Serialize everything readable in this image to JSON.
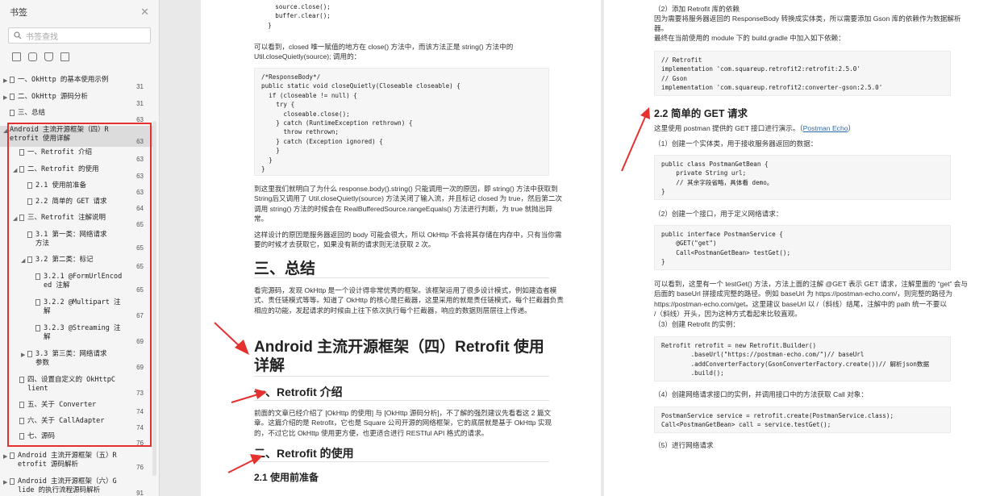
{
  "sidebar": {
    "title": "书签",
    "search_placeholder": "书签查找",
    "items": [
      {
        "label": "一、OkHttp 的基本使用示例",
        "page": "31"
      },
      {
        "label": "二、OkHttp 源码分析",
        "page": "31"
      },
      {
        "label": "三、总结",
        "page": "63"
      },
      {
        "label": "Android 主流开源框架（四）R",
        "label2": "etrofit 使用详解",
        "page": "63"
      },
      {
        "label": "一、Retrofit 介绍",
        "page": "63"
      },
      {
        "label": "二、Retrofit 的使用",
        "page": "63"
      },
      {
        "label": "2.1 使用前准备",
        "page": "63"
      },
      {
        "label": "2.2 简单的 GET 请求",
        "page": "64"
      },
      {
        "label": "三、Retrofit 注解说明",
        "page": "65"
      },
      {
        "label": "3.1 第一类：网络请求",
        "label2": "方法",
        "page": "65"
      },
      {
        "label": "3.2 第二类：标记",
        "page": "65"
      },
      {
        "label": "3.2.1 @FormUrlEncod",
        "label2": "ed 注解",
        "page": "65"
      },
      {
        "label": "3.2.2 @Multipart 注",
        "label2": "解",
        "page": "67"
      },
      {
        "label": "3.2.3 @Streaming 注",
        "label2": "解",
        "page": "69"
      },
      {
        "label": "3.3 第三类：网络请求",
        "label2": "参数",
        "page": "69"
      },
      {
        "label": "四、设置自定义的 OkHttpC",
        "label2": "lient",
        "page": "73"
      },
      {
        "label": "五、关于 Converter",
        "page": "74"
      },
      {
        "label": "六、关于 CallAdapter",
        "page": "74"
      },
      {
        "label": "七、源码",
        "page": "76"
      },
      {
        "label": "Android 主流开源框架（五）R",
        "label2": "etrofit 源码解析",
        "page": "76"
      },
      {
        "label": "Android 主流开源框架（六）G",
        "label2": "lide 的执行流程源码解析",
        "page": "91"
      }
    ]
  },
  "page1": {
    "code_top": "    source.close();\n    buffer.clear();\n  }",
    "p1": "可以看到，closed 唯一赋值的地方在 close() 方法中，而该方法正是 string() 方法中的",
    "p1b": "Util.closeQuietly(source); 调用的：",
    "code_mid": "/*ResponseBody*/\npublic static void closeQuietly(Closeable closeable) {\n  if (closeable != null) {\n    try {\n      closeable.close();\n    } catch (RuntimeException rethrown) {\n      throw rethrown;\n    } catch (Exception ignored) {\n    }\n  }\n}",
    "p2": [
      "到这里我们就明白了为什么 response.body().string() 只能调用一次的原因，即 string() 方法中获取到",
      "String后又调用了 Util.closeQuietly(source) 方法关闭了输入流，并且标记 closed 为 true，然后第二次",
      "调用 string() 方法的时候会在 RealBufferedSource.rangeEquals() 方法进行判断，为 true 就抛出异",
      "常。"
    ],
    "p3": [
      "这样设计的原因是服务器返回的 body 可能会很大，所以 OkHttp 不会将其存储在内存中，只有当你需",
      "要的时候才去获取它，如果没有新的请求则无法获取 2 次。"
    ],
    "h_summary": "三、总结",
    "p4": [
      "看完源码，发现 OkHttp 是一个设计得非常优秀的框架。该框架运用了很多设计模式，例如建造者模",
      "式、责任链模式等等。知道了 OkHttp 的核心是拦截器，这里采用的就是责任链模式，每个拦截器负责",
      "相应的功能，发起请求的时候由上往下依次执行每个拦截器，响应的数据则层层往上传递。"
    ],
    "h_main_1": "Android 主流开源框架（四）Retrofit 使用",
    "h_main_2": "详解",
    "h_intro": "一、Retrofit 介绍",
    "p5": [
      "前面的文章已经介绍了 [OkHttp 的使用] 与 [OkHttp 源码分析]，不了解的强烈建议先看看这 2 篇文",
      "章。这篇介绍的是 Retrofit，它也是 Square 公司开源的网络框架，它的底层就是基于 OkHttp 实现",
      "的，不过它比 OkHttp 使用更方便，也更适合进行 RESTful API 格式的请求。"
    ],
    "h_use": "二、Retrofit 的使用",
    "h_prep": "2.1 使用前准备"
  },
  "page2": {
    "t1": "（2）添加 Retrofit 库的依赖",
    "t2": [
      "因为需要将服务器返回的 ResponseBody 转换成实体类，所以需要添加 Gson 库的依赖作为数据解析",
      "器。"
    ],
    "t3": "最终在当前使用的 module 下的 build.gradle 中加入如下依赖：",
    "code1": "// Retrofit\nimplementation 'com.squareup.retrofit2:retrofit:2.5.0'\n// Gson\nimplementation 'com.squareup.retrofit2:converter-gson:2.5.0'",
    "h_get": "2.2 简单的 GET 请求",
    "t4": "这里使用 postman 提供的 GET 接口进行演示。（",
    "t4_link": "Postman Echo",
    "t4_end": "）",
    "t5": "（1）创建一个实体类，用于接收服务器返回的数据：",
    "code2": "public class PostmanGetBean {\n    private String url;\n    // 其余字段省略，具体看 demo。\n}",
    "t6": "（2）创建一个接口，用于定义网络请求：",
    "code3": "public interface PostmanService {\n    @GET(\"get\")\n    Call<PostmanGetBean> testGet();\n}",
    "t7": [
      "可以看到，这里有一个 testGet() 方法，方法上面的注解 @GET 表示 GET 请求，注解里面的 “get” 会与",
      "后面的 baseUrl 拼接成完整的路径。例如 baseUrl 为 https://postman-echo.com/，则完整的路径为",
      "https://postman-echo.com/get。这里建议 baseUrl 以 /（斜线）结尾，注解中的 path 统一不要以",
      "/（斜线）开头，因为这种方式看起来比较直观。"
    ],
    "t8": "（3）创建 Retrofit 的实例：",
    "code4": "Retrofit retrofit = new Retrofit.Builder()\n        .baseUrl(\"https://postman-echo.com/\")// baseUrl\n        .addConverterFactory(GsonConverterFactory.create())// 解析json数据\n        .build();",
    "t9": "（4）创建网络请求接口的实例，并调用接口中的方法获取 Call 对象：",
    "code5": "PostmanService service = retrofit.create(PostmanService.class);\nCall<PostmanGetBean> call = service.testGet();",
    "t10": "（5）进行网络请求"
  },
  "colors": {
    "highlight": "#e53030",
    "arrow": "#e53030",
    "link": "#2b6cb0"
  }
}
